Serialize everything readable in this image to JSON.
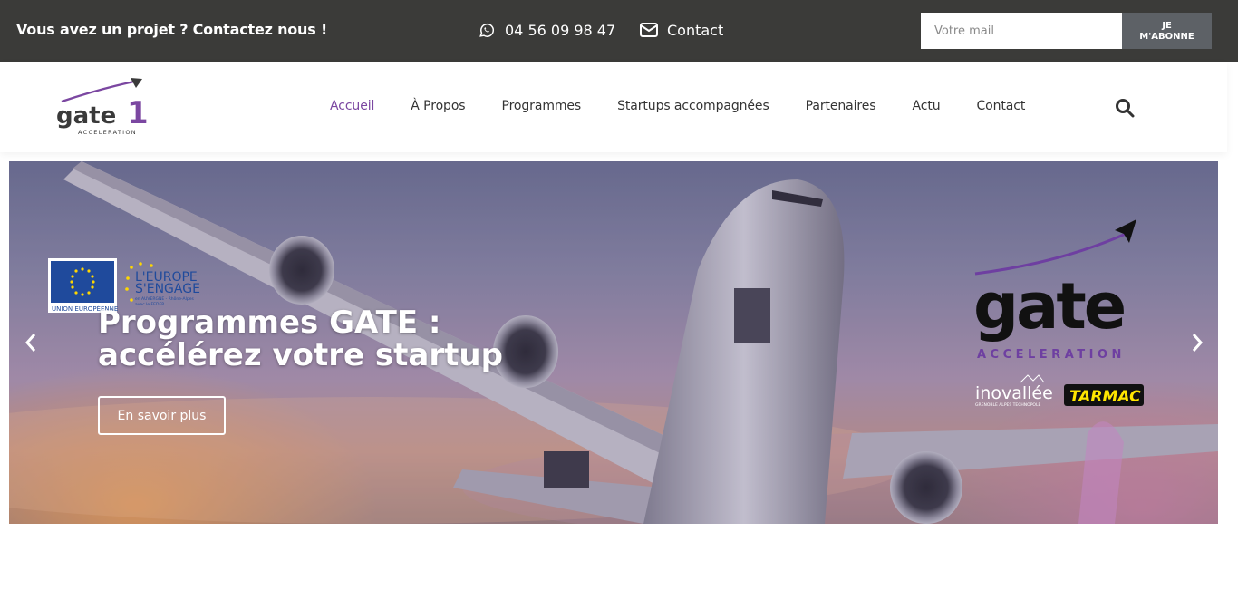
{
  "topbar": {
    "tagline": "Vous avez un projet ? Contactez nous !",
    "phone": "04 56 09 98 47",
    "contact": "Contact",
    "newsletter": {
      "placeholder": "Votre mail",
      "button_line1": "JE",
      "button_line2": "M'ABONNE"
    }
  },
  "header": {
    "logo_text": "gate",
    "logo_number": "1",
    "logo_sub": "ACCELERATION",
    "nav": [
      {
        "label": "Accueil",
        "active": true
      },
      {
        "label": "À Propos",
        "active": false
      },
      {
        "label": "Programmes",
        "active": false
      },
      {
        "label": "Startups accompagnées",
        "active": false
      },
      {
        "label": "Partenaires",
        "active": false
      },
      {
        "label": "Actu",
        "active": false
      },
      {
        "label": "Contact",
        "active": false
      }
    ]
  },
  "slider": {
    "title": "Programmes GATE : accélérez votre startup",
    "cta": "En savoir plus",
    "eu": {
      "union": "UNION EUROPÉENNE",
      "line1": "L'EUROPE",
      "line2": "S'ENGAGE",
      "line3": "en AUVERGNE - Rhône-Alpes",
      "line4": "avec le FEDER"
    },
    "gate_logo": {
      "word": "gate",
      "sub": "ACCELERATION"
    },
    "partners": {
      "inovallee": "inovallée",
      "inovallee_sub": "GRENOBLE ALPES TECHNOPOLE",
      "tarmac": "TARMAC"
    }
  },
  "colors": {
    "topbar_bg": "#3b3b39",
    "accent": "#7b47a1",
    "button_bg": "#5d6166"
  }
}
